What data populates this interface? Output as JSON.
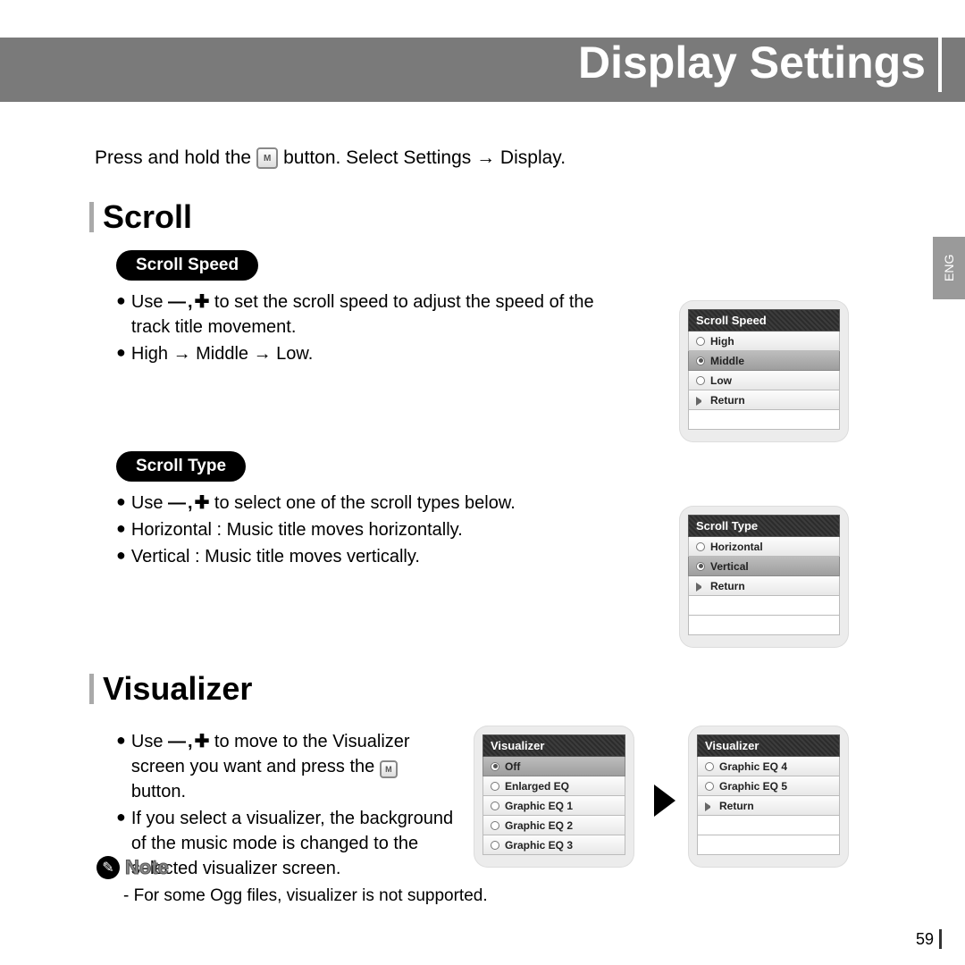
{
  "header": {
    "title": "Display Settings"
  },
  "lang_tab": "ENG",
  "intro": {
    "before": "Press and hold the",
    "after": "button. Select Settings → Display."
  },
  "section_scroll": {
    "heading": "Scroll",
    "scroll_speed": {
      "label": "Scroll Speed",
      "line1_before": "Use",
      "line1_after": "to set the scroll speed to adjust the speed of the track title movement.",
      "line2": "High → Middle → Low."
    },
    "scroll_type": {
      "label": "Scroll Type",
      "line1_before": "Use",
      "line1_after": "to select one of the scroll types below.",
      "line2": "Horizontal : Music title moves horizontally.",
      "line3": "Vertical : Music title moves vertically."
    }
  },
  "section_visualizer": {
    "heading": "Visualizer",
    "line1_before": "Use",
    "line1_mid": "to move to the Visualizer screen you want and press the",
    "line1_after": "button.",
    "line2": "If you select a visualizer, the background of the music mode is changed to the selected visualizer screen."
  },
  "note": {
    "label": "Note",
    "detail": "- For some Ogg files, visualizer is not supported."
  },
  "devices": {
    "scroll_speed": {
      "title": "Scroll Speed",
      "items": [
        "High",
        "Middle",
        "Low",
        "Return"
      ],
      "selected_index": 1
    },
    "scroll_type": {
      "title": "Scroll Type",
      "items": [
        "Horizontal",
        "Vertical",
        "Return"
      ],
      "selected_index": 1
    },
    "visualizer1": {
      "title": "Visualizer",
      "items": [
        "Off",
        "Enlarged EQ",
        "Graphic EQ 1",
        "Graphic EQ 2",
        "Graphic EQ 3"
      ],
      "selected_index": 0
    },
    "visualizer2": {
      "title": "Visualizer",
      "items": [
        "Graphic EQ 4",
        "Graphic EQ 5",
        "Return"
      ],
      "selected_index": -1
    }
  },
  "page_number": "59",
  "icons": {
    "minus": "—",
    "plus": "✚",
    "comma": ","
  }
}
